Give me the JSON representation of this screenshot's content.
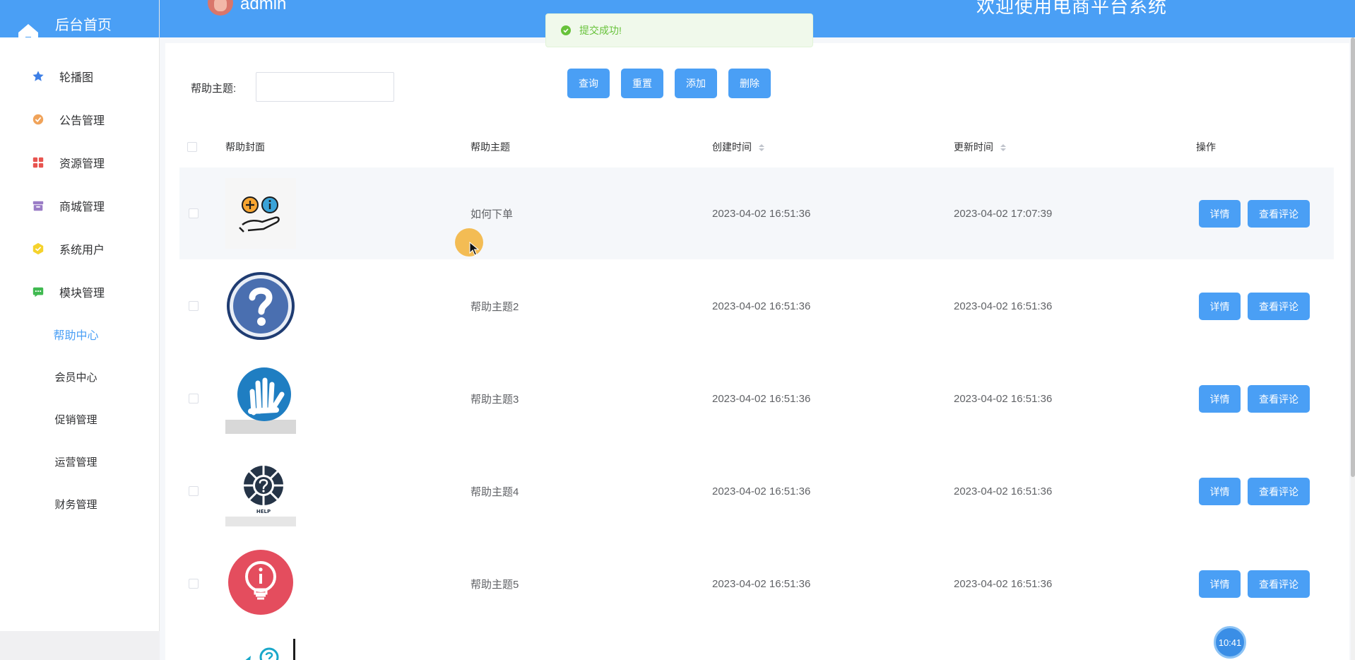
{
  "sidebar": {
    "home_label": "后台首页",
    "menu": [
      {
        "label": "轮播图",
        "icon": "star-icon",
        "color": "#3d7fe6"
      },
      {
        "label": "公告管理",
        "icon": "badge-icon",
        "color": "#f0a35a"
      },
      {
        "label": "资源管理",
        "icon": "grid-icon",
        "color": "#e8544f"
      },
      {
        "label": "商城管理",
        "icon": "archive-icon",
        "color": "#9a7cc6"
      },
      {
        "label": "系统用户",
        "icon": "cube-icon",
        "color": "#f5d22c"
      },
      {
        "label": "模块管理",
        "icon": "message-icon",
        "color": "#3fb950"
      }
    ],
    "submenu": [
      {
        "label": "帮助中心",
        "active": true
      },
      {
        "label": "会员中心"
      },
      {
        "label": "促销管理"
      },
      {
        "label": "运营管理"
      },
      {
        "label": "财务管理"
      }
    ]
  },
  "header": {
    "user": "admin",
    "welcome": "欢迎使用电商平台系统"
  },
  "toast": {
    "text": "提交成功!"
  },
  "search": {
    "label": "帮助主题:",
    "value": "",
    "buttons": {
      "query": "查询",
      "reset": "重置",
      "add": "添加",
      "delete": "删除"
    }
  },
  "table": {
    "columns": {
      "cover": "帮助封面",
      "topic": "帮助主题",
      "created": "创建时间",
      "updated": "更新时间",
      "ops": "操作"
    },
    "rows": [
      {
        "topic": "如何下单",
        "created": "2023-04-02 16:51:36",
        "updated": "2023-04-02 17:07:39",
        "cover_icon": "hand-plus-info-icon"
      },
      {
        "topic": "帮助主题2",
        "created": "2023-04-02 16:51:36",
        "updated": "2023-04-02 16:51:36",
        "cover_icon": "question-circle-icon"
      },
      {
        "topic": "帮助主题3",
        "created": "2023-04-02 16:51:36",
        "updated": "2023-04-02 16:51:36",
        "cover_icon": "sign-hand-icon"
      },
      {
        "topic": "帮助主题4",
        "created": "2023-04-02 16:51:36",
        "updated": "2023-04-02 16:51:36",
        "cover_icon": "help-wheel-icon"
      },
      {
        "topic": "帮助主题5",
        "created": "2023-04-02 16:51:36",
        "updated": "2023-04-02 16:51:36",
        "cover_icon": "lightbulb-info-icon"
      }
    ],
    "op_detail": "详情",
    "op_comments": "查看评论"
  },
  "help_cover_text": "HELP",
  "clock": "10:41",
  "colors": {
    "primary": "#4a9ff5",
    "success": "#67c23a"
  }
}
